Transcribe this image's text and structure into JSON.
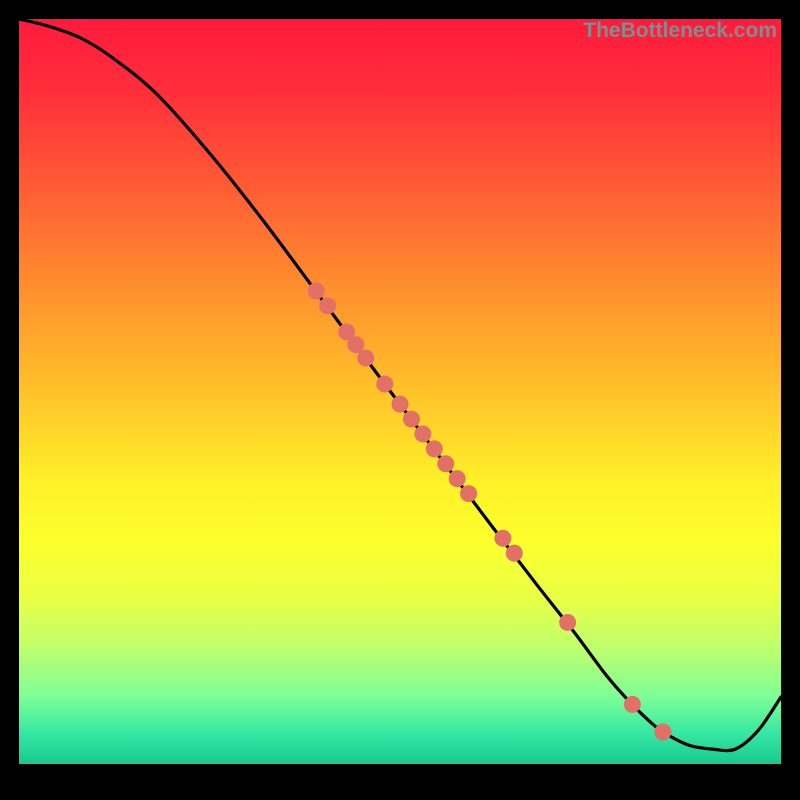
{
  "watermark": "TheBottleneck.com",
  "gradient": {
    "stops": [
      {
        "offset": 0.0,
        "color": "#ff1a3d"
      },
      {
        "offset": 0.1,
        "color": "#ff2f3a"
      },
      {
        "offset": 0.22,
        "color": "#ff5a34"
      },
      {
        "offset": 0.35,
        "color": "#ff8b2e"
      },
      {
        "offset": 0.5,
        "color": "#ffc229"
      },
      {
        "offset": 0.62,
        "color": "#fff028"
      },
      {
        "offset": 0.7,
        "color": "#fcff2c"
      },
      {
        "offset": 0.78,
        "color": "#e8ff45"
      },
      {
        "offset": 0.85,
        "color": "#b9ff70"
      },
      {
        "offset": 0.91,
        "color": "#7cff97"
      },
      {
        "offset": 0.96,
        "color": "#33e7a2"
      },
      {
        "offset": 1.0,
        "color": "#18c98f"
      }
    ]
  },
  "chart_data": {
    "type": "line",
    "title": "",
    "xlabel": "",
    "ylabel": "",
    "xlim": [
      0,
      100
    ],
    "ylim": [
      0,
      100
    ],
    "series": [
      {
        "name": "curve",
        "x": [
          0,
          4,
          8,
          12,
          18,
          25,
          32,
          40,
          48,
          55,
          62,
          68,
          73,
          77,
          80,
          83,
          85,
          88,
          91,
          94,
          97,
          100
        ],
        "y": [
          100,
          99,
          97.5,
          95,
          90,
          82,
          73,
          62,
          51,
          41.5,
          32,
          24,
          17.5,
          12,
          8.5,
          5.5,
          4,
          2.5,
          2.0,
          2.0,
          4.5,
          9
        ]
      }
    ],
    "markers": {
      "name": "points",
      "x": [
        39,
        40.5,
        43,
        44.2,
        45.5,
        48,
        50,
        51.5,
        53,
        54.5,
        56,
        57.5,
        59,
        63.5,
        65,
        72,
        80.5,
        84.5
      ],
      "y": [
        63.5,
        61.5,
        58,
        56.3,
        54.5,
        51,
        48.3,
        46.3,
        44.3,
        42.3,
        40.3,
        38.3,
        36.3,
        30.3,
        28.3,
        19,
        8,
        4.3
      ]
    },
    "marker_style": {
      "fill": "#e27066",
      "r": 8.5
    }
  }
}
